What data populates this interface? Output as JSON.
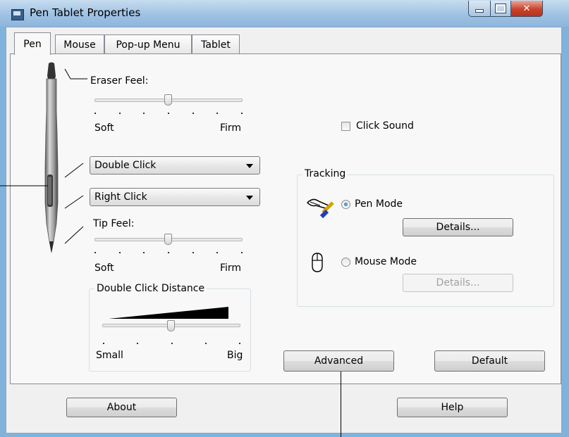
{
  "window": {
    "title": "Pen Tablet Properties",
    "colors": {
      "accent": "#7fb3dc",
      "close": "#c8432c"
    }
  },
  "tabs": [
    {
      "label": "Pen",
      "selected": true
    },
    {
      "label": "Mouse",
      "selected": false
    },
    {
      "label": "Pop-up Menu",
      "selected": false
    },
    {
      "label": "Tablet",
      "selected": false
    }
  ],
  "pen": {
    "eraser_feel": {
      "label": "Eraser Feel:",
      "min_label": "Soft",
      "max_label": "Firm",
      "level": 0.5
    },
    "upper_button": {
      "value": "Double Click"
    },
    "lower_button": {
      "value": "Right Click"
    },
    "tip_feel": {
      "label": "Tip Feel:",
      "min_label": "Soft",
      "max_label": "Firm",
      "level": 0.5
    },
    "double_click_distance": {
      "label": "Double Click Distance",
      "min_label": "Small",
      "max_label": "Big",
      "level": 0.5
    }
  },
  "click_sound": {
    "label": "Click Sound",
    "checked": false
  },
  "tracking": {
    "label": "Tracking",
    "pen_mode": {
      "label": "Pen Mode",
      "selected": true,
      "details": "Details...",
      "enabled": true
    },
    "mouse_mode": {
      "label": "Mouse Mode",
      "selected": false,
      "details": "Details...",
      "enabled": false
    },
    "pen_icon": "pen-tracking-icon",
    "mouse_icon": "mouse-icon"
  },
  "buttons": {
    "advanced": "Advanced",
    "default": "Default",
    "about": "About",
    "help": "Help"
  }
}
